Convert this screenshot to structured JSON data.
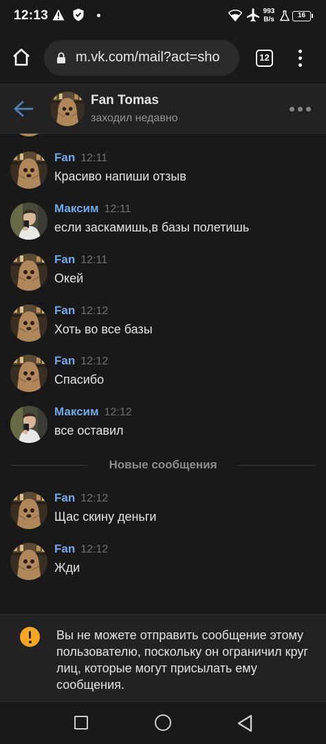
{
  "status_bar": {
    "time": "12:13",
    "net_speed_value": "993",
    "net_speed_unit": "B/s",
    "battery": "16",
    "icons": [
      "warning-icon",
      "shield-icon",
      "dot-icon",
      "wifi-icon",
      "airplane-icon",
      "flask-icon",
      "battery-icon"
    ]
  },
  "browser": {
    "url": "m.vk.com/mail?act=sho",
    "tab_count": "12",
    "icons": [
      "home-icon",
      "lock-icon",
      "tabs-icon",
      "menu-icon"
    ]
  },
  "chat": {
    "name": "Fan Tomas",
    "status": "заходил недавно"
  },
  "messages": [
    {
      "author": "Fan",
      "time": "12:11",
      "text": "Красиво напиши отзыв",
      "avatar": "fan"
    },
    {
      "author": "Максим",
      "time": "12:11",
      "text": "если заскамишь,в базы полетишь",
      "avatar": "maxim"
    },
    {
      "author": "Fan",
      "time": "12:11",
      "text": "Окей",
      "avatar": "fan"
    },
    {
      "author": "Fan",
      "time": "12:12",
      "text": "Хоть во все базы",
      "avatar": "fan"
    },
    {
      "author": "Fan",
      "time": "12:12",
      "text": "Спасибо",
      "avatar": "fan"
    },
    {
      "author": "Максим",
      "time": "12:12",
      "text": "все оставил",
      "avatar": "maxim"
    }
  ],
  "new_messages_divider": "Новые сообщения",
  "new_messages": [
    {
      "author": "Fan",
      "time": "12:12",
      "text": "Щас скину деньги",
      "avatar": "fan"
    },
    {
      "author": "Fan",
      "time": "12:12",
      "text": "Жди",
      "avatar": "fan"
    }
  ],
  "notice": {
    "text": "Вы не можете отправить сообщение этому пользователю, поскольку он ограничил круг лиц, которые могут присылать ему сообщения.",
    "icon": "warning-circle-icon",
    "accent": "#f5a623"
  },
  "colors": {
    "author": "#71aaeb",
    "accent_blue": "#5181b8",
    "background": "#19191a"
  },
  "nav": {
    "icons": [
      "recent-apps-icon",
      "home-circle-icon",
      "back-triangle-icon"
    ]
  }
}
